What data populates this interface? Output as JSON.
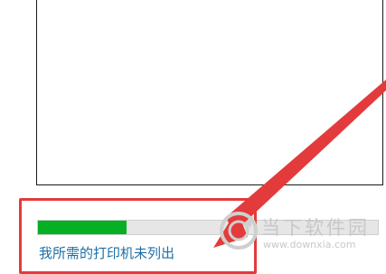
{
  "dialog": {
    "progress": {
      "fraction": 0.26,
      "color": "#06b025"
    },
    "printer_not_listed_link": "我所需的打印机未列出"
  },
  "annotation": {
    "color": "#e33b3b"
  },
  "watermark": {
    "site_name": "当下软件园",
    "url": "www.downxia.com",
    "logo_icon": "downxia-logo-icon"
  }
}
